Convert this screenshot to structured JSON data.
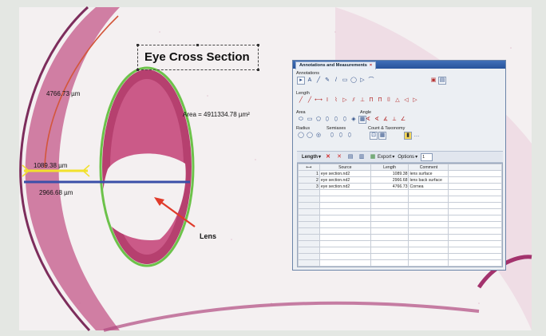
{
  "image": {
    "title": "Eye Cross Section",
    "measurements": {
      "cornea_length": "4766.73 µm",
      "lens_area": "Area = 4911334.78 µm²",
      "lens_surface": "1089.38 µm",
      "lens_back_surface": "2966.68 µm"
    },
    "arrow_label": "Lens"
  },
  "panel": {
    "tab_title": "Annotations and Measurements",
    "tab_close": "×",
    "sections": {
      "annotations": "Annotations",
      "length": "Length",
      "area": "Area",
      "angle": "Angle",
      "radius": "Radius",
      "semiaxes": "Semiaxes",
      "count_taxonomy": "Count & Taxonomy"
    },
    "toolbar": {
      "mode": "Length",
      "export": "Export",
      "options": "Options",
      "spin_value": "1"
    },
    "table": {
      "columns": [
        "Source",
        "Length",
        "Comment"
      ],
      "rows": [
        {
          "index": "1",
          "source": "eye section.nd2",
          "length": "1089.38",
          "comment": "lens surface"
        },
        {
          "index": "2",
          "source": "eye section.nd2",
          "length": "2966.68",
          "comment": "lens back surface"
        },
        {
          "index": "3",
          "source": "eye section.nd2",
          "length": "4766.73",
          "comment": "Cornea"
        }
      ]
    }
  },
  "colors": {
    "tissue": "#c96a95",
    "lens_outline": "#6cc24a",
    "blue_line": "#3a4fa8",
    "yellow_line": "#f2e12c",
    "arrow": "#e03a2a"
  }
}
